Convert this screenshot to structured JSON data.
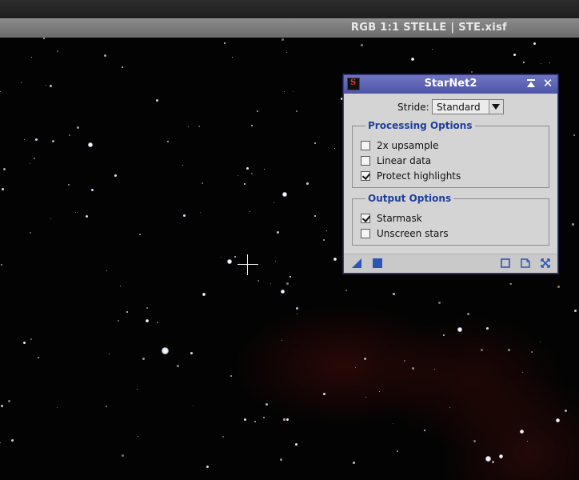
{
  "image_window": {
    "title": "RGB 1:1 STELLE | STE.xisf"
  },
  "dialog": {
    "title": "StarNet2",
    "stride": {
      "label": "Stride:",
      "value": "Standard"
    },
    "processing_options": {
      "title": "Processing Options",
      "items": [
        {
          "label": "2x upsample",
          "checked": false
        },
        {
          "label": "Linear data",
          "checked": false
        },
        {
          "label": "Protect highlights",
          "checked": true
        }
      ]
    },
    "output_options": {
      "title": "Output Options",
      "items": [
        {
          "label": "Starmask",
          "checked": true
        },
        {
          "label": "Unscreen stars",
          "checked": false
        }
      ]
    },
    "colors": {
      "titlebar": "#5b62b4",
      "group_title": "#1f3f9a",
      "icon_blue": "#2a55b8"
    },
    "icons": {
      "app": "starnet-app-icon",
      "shade": "shade-icon",
      "close": "close-icon",
      "new_instance": "new-instance-icon",
      "apply": "apply-global-icon",
      "browse_doc": "browse-documentation-icon",
      "reset": "reset-icon",
      "preferences": "preferences-icon"
    }
  }
}
